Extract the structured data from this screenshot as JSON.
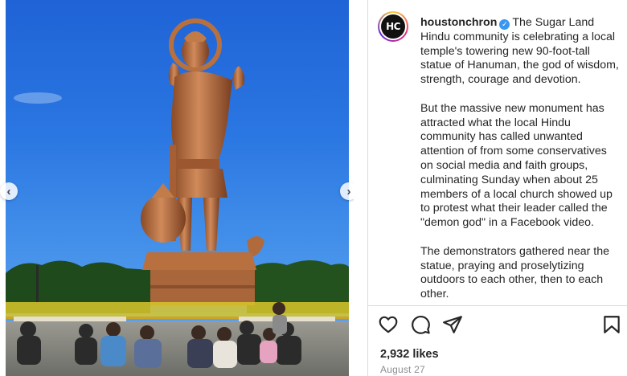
{
  "post": {
    "username": "houstonchron",
    "avatar_text": "HC",
    "verified_icon": "verified-badge-icon",
    "caption_first": "The Sugar Land Hindu community is celebrating a local temple's towering new 90-foot-tall statue of Hanuman, the god of wisdom, strength, courage and devotion.",
    "paragraph_2": "But the massive new monument has attracted what the local Hindu community has called unwanted attention of from some conservatives on social media and faith groups, culminating Sunday when about 25 members of a local church showed up to protest what their leader called the \"demon god\" in a Facebook video.",
    "paragraph_3": "The demonstrators gathered near the statue, praying and proselytizing outdoors to each other, then to each other.",
    "likes": "2,932 likes",
    "date": "August 27"
  },
  "media": {
    "prev_arrow": "‹",
    "next_arrow": "›",
    "image_alt": "Hanuman statue with kneeling protesters"
  },
  "actions": {
    "like_icon": "heart-icon",
    "comment_icon": "comment-icon",
    "share_icon": "send-icon",
    "save_icon": "bookmark-icon"
  },
  "colors": {
    "verified": "#3897f0",
    "text": "#262626",
    "muted": "#8e8e8e",
    "statue": "#b86a3e"
  }
}
